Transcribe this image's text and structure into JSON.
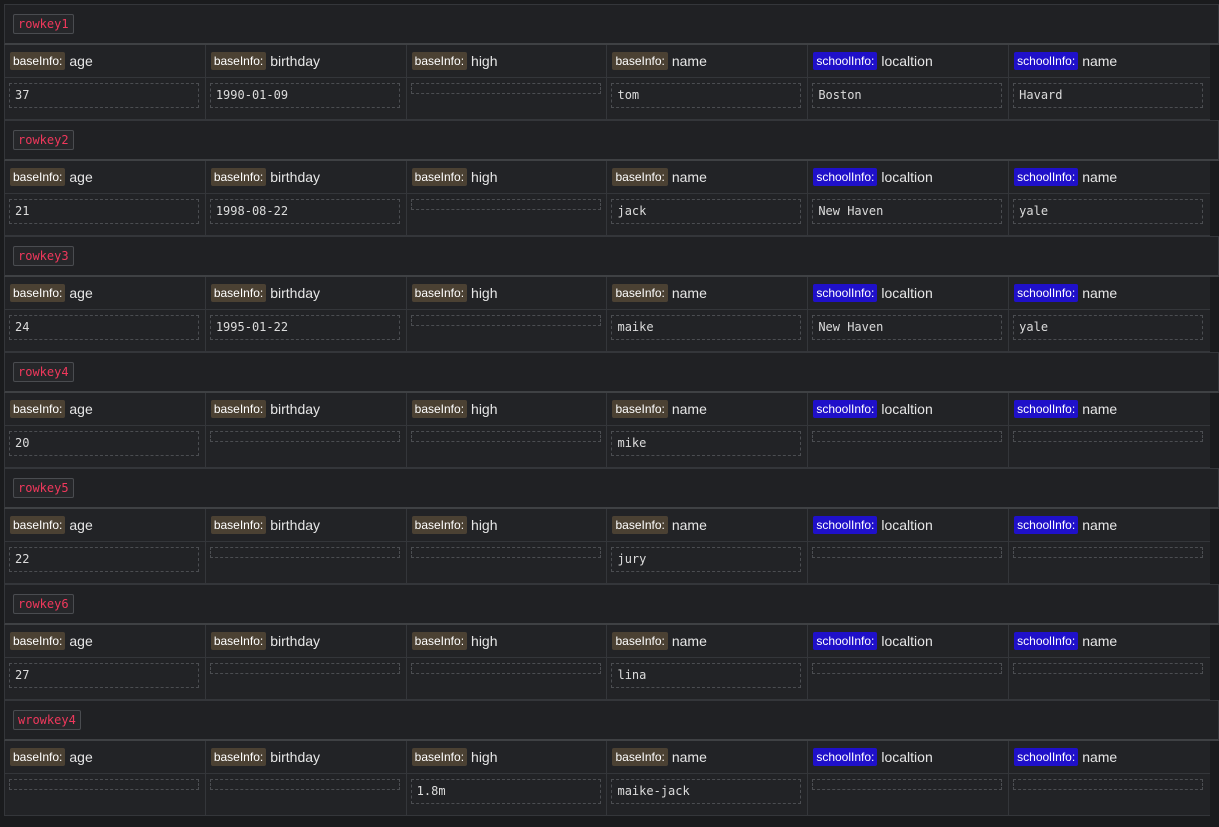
{
  "columns": [
    {
      "family": "baseInfo:",
      "qualifier": "age",
      "family_color": "#4b4133"
    },
    {
      "family": "baseInfo:",
      "qualifier": "birthday",
      "family_color": "#4b4133"
    },
    {
      "family": "baseInfo:",
      "qualifier": "high",
      "family_color": "#4b4133"
    },
    {
      "family": "baseInfo:",
      "qualifier": "name",
      "family_color": "#4b4133"
    },
    {
      "family": "schoolInfo:",
      "qualifier": "localtion",
      "family_color": "#1f10c9"
    },
    {
      "family": "schoolInfo:",
      "qualifier": "name",
      "family_color": "#1f10c9"
    }
  ],
  "rows": [
    {
      "rowkey": "rowkey1",
      "values": [
        "37",
        "1990-01-09",
        "",
        "tom",
        "Boston",
        "Havard"
      ]
    },
    {
      "rowkey": "rowkey2",
      "values": [
        "21",
        "1998-08-22",
        "",
        "jack",
        "New Haven",
        "yale"
      ]
    },
    {
      "rowkey": "rowkey3",
      "values": [
        "24",
        "1995-01-22",
        "",
        "maike",
        "New Haven",
        "yale"
      ]
    },
    {
      "rowkey": "rowkey4",
      "values": [
        "20",
        "",
        "",
        "mike",
        "",
        ""
      ]
    },
    {
      "rowkey": "rowkey5",
      "values": [
        "22",
        "",
        "",
        "jury",
        "",
        ""
      ]
    },
    {
      "rowkey": "rowkey6",
      "values": [
        "27",
        "",
        "",
        "lina",
        "",
        ""
      ]
    },
    {
      "rowkey": "wrowkey4",
      "values": [
        "",
        "",
        "1.8m",
        "maike-jack",
        "",
        ""
      ]
    }
  ],
  "colors": {
    "rowkey_text": "#f0385c",
    "background": "#1a1b1d"
  }
}
